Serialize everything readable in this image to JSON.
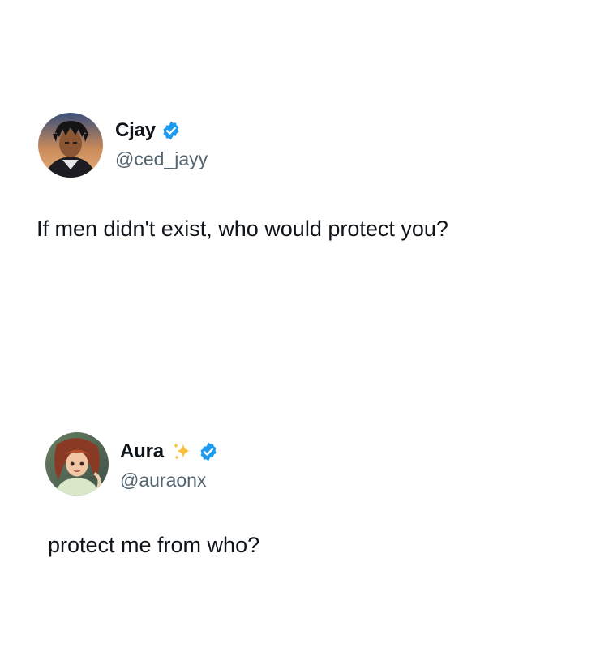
{
  "tweets": [
    {
      "display_name": "Cjay",
      "handle": "@ced_jayy",
      "verified": true,
      "text": "If men didn't exist, who would protect you?",
      "avatar": "anime-boy-avatar"
    },
    {
      "display_name": "Aura",
      "handle": "@auraonx",
      "verified": true,
      "name_emoji": "sparkles-icon",
      "text": "protect me from who?",
      "avatar": "anime-girl-avatar"
    }
  ],
  "colors": {
    "verified_blue": "#1d9bf0",
    "handle_gray": "#536471",
    "text": "#0f1419",
    "sparkle_yellow": "#f7c23a"
  }
}
